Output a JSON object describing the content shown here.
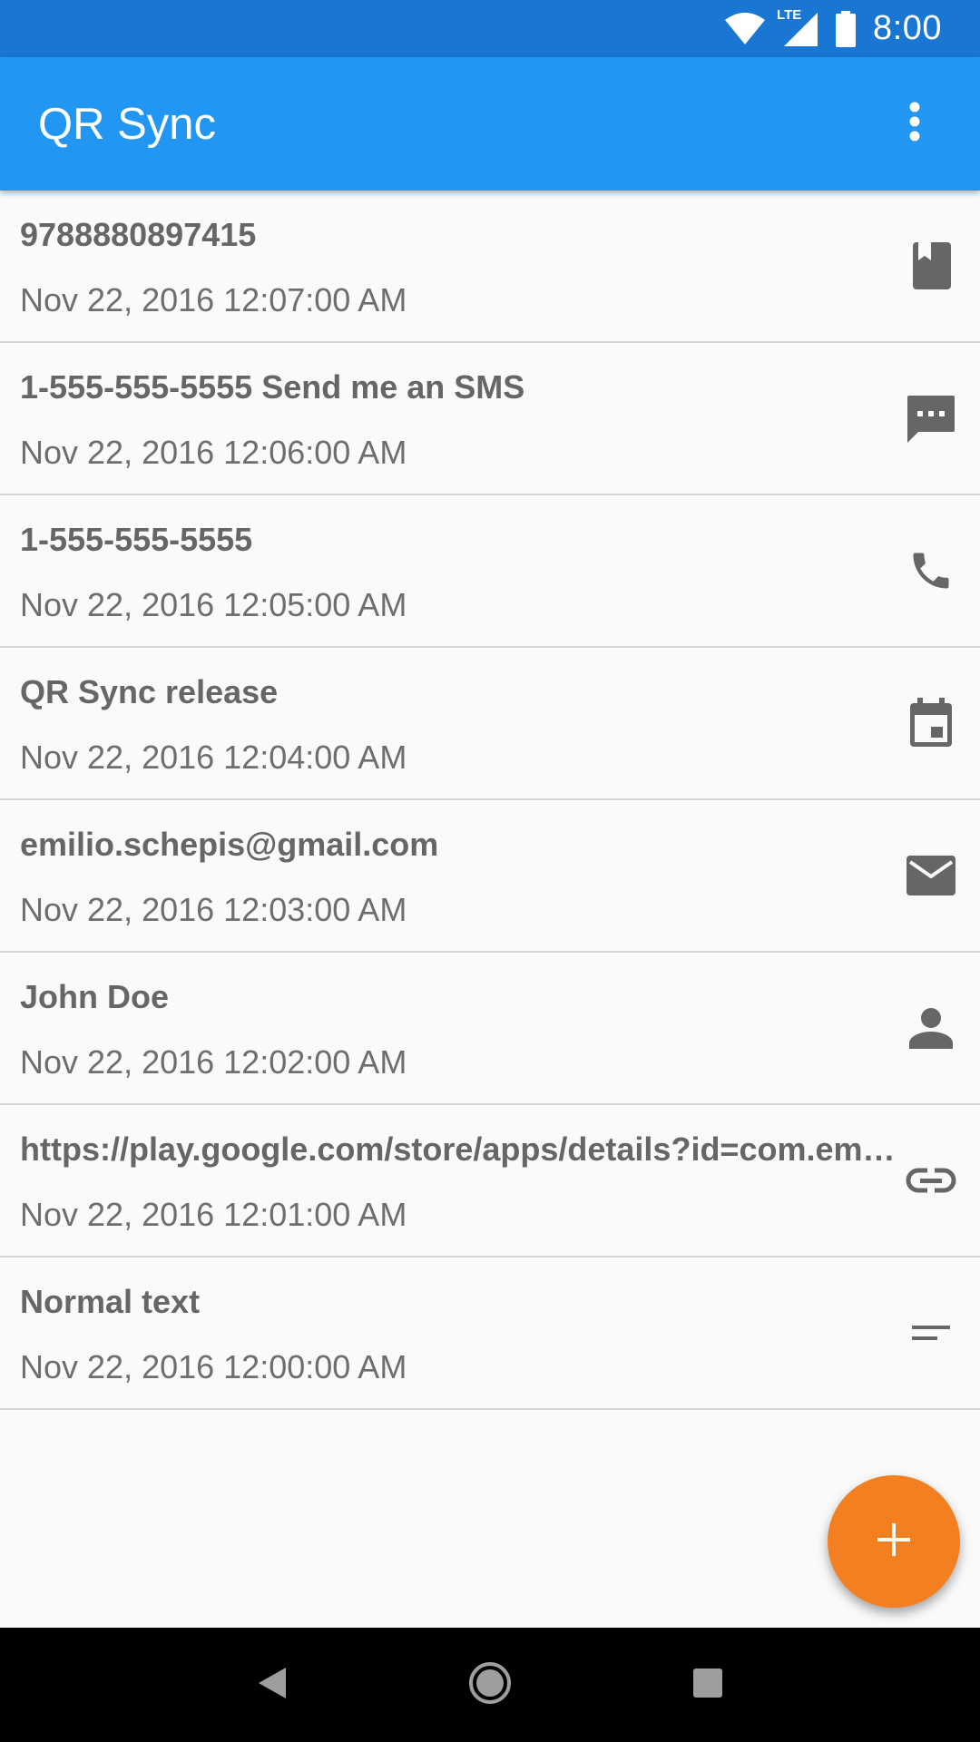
{
  "status_bar": {
    "network_label": "LTE",
    "time": "8:00"
  },
  "app_bar": {
    "title": "QR Sync",
    "overflow_icon": "more-vert-icon"
  },
  "items": [
    {
      "title": "9788880897415",
      "date": "Nov 22, 2016 12:07:00 AM",
      "icon": "book-icon"
    },
    {
      "title": "1-555-555-5555 Send me an SMS",
      "date": "Nov 22, 2016 12:06:00 AM",
      "icon": "sms-icon"
    },
    {
      "title": "1-555-555-5555",
      "date": "Nov 22, 2016 12:05:00 AM",
      "icon": "phone-icon"
    },
    {
      "title": "QR Sync release",
      "date": "Nov 22, 2016 12:04:00 AM",
      "icon": "calendar-icon"
    },
    {
      "title": "emilio.schepis@gmail.com",
      "date": "Nov 22, 2016 12:03:00 AM",
      "icon": "email-icon"
    },
    {
      "title": "John Doe",
      "date": "Nov 22, 2016 12:02:00 AM",
      "icon": "person-icon"
    },
    {
      "title": "https://play.google.com/store/apps/details?id=com.emilioschepis.qrsync",
      "date": "Nov 22, 2016 12:01:00 AM",
      "icon": "link-icon"
    },
    {
      "title": "Normal text",
      "date": "Nov 22, 2016 12:00:00 AM",
      "icon": "text-icon"
    }
  ],
  "fab": {
    "icon": "add-icon"
  },
  "colors": {
    "status_bar": "#1976d2",
    "app_bar": "#2196f3",
    "fab": "#f47f20",
    "icon_gray": "#666666"
  }
}
